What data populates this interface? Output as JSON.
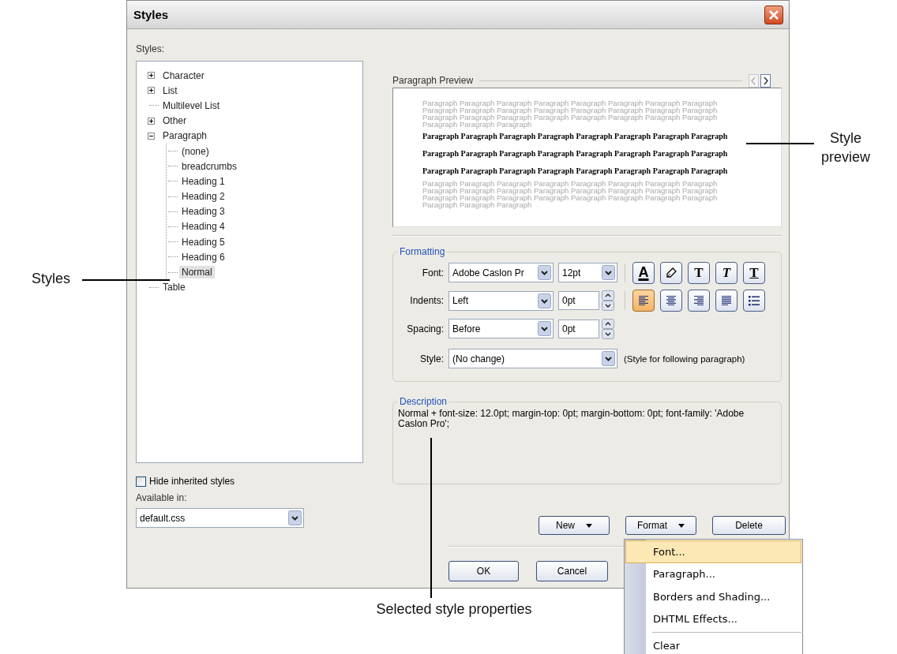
{
  "window": {
    "title": "Styles"
  },
  "styles_panel": {
    "label": "Styles:",
    "tree": [
      {
        "label": "Character",
        "selected": false,
        "expanded": false
      },
      {
        "label": "List",
        "selected": false,
        "expanded": false
      },
      {
        "label": "Multilevel List",
        "selected": false
      },
      {
        "label": "Other",
        "selected": false,
        "expanded": false
      },
      {
        "label": "Paragraph",
        "selected": false,
        "expanded": true,
        "children": [
          {
            "label": "(none)",
            "selected": false
          },
          {
            "label": "breadcrumbs",
            "selected": false
          },
          {
            "label": "Heading 1",
            "selected": false
          },
          {
            "label": "Heading 2",
            "selected": false
          },
          {
            "label": "Heading 3",
            "selected": false
          },
          {
            "label": "Heading 4",
            "selected": false
          },
          {
            "label": "Heading 5",
            "selected": false
          },
          {
            "label": "Heading 6",
            "selected": false
          },
          {
            "label": "Normal",
            "selected": true
          }
        ]
      },
      {
        "label": "Table",
        "selected": false
      }
    ],
    "hide_inherited": {
      "label": "Hide inherited styles",
      "checked": false
    },
    "available_in": {
      "label": "Available in:",
      "value": "default.css"
    }
  },
  "preview": {
    "label": "Paragraph Preview",
    "before": "Paragraph Paragraph Paragraph Paragraph Paragraph Paragraph Paragraph Paragraph Paragraph Paragraph Paragraph Paragraph Paragraph Paragraph Paragraph Paragraph Paragraph Paragraph Paragraph Paragraph Paragraph Paragraph Paragraph Paragraph Paragraph Paragraph Paragraph",
    "sample": "Paragraph Paragraph Paragraph Paragraph Paragraph Paragraph Paragraph Paragraph Paragraph Paragraph Paragraph Paragraph Paragraph Paragraph Paragraph Paragraph Paragraph Paragraph Paragraph Paragraph Paragraph Paragraph Paragraph Paragraph",
    "after": "Paragraph Paragraph Paragraph Paragraph Paragraph Paragraph Paragraph Paragraph Paragraph Paragraph Paragraph Paragraph Paragraph Paragraph Paragraph Paragraph Paragraph Paragraph Paragraph Paragraph Paragraph Paragraph Paragraph Paragraph Paragraph Paragraph Paragraph"
  },
  "formatting": {
    "label": "Formatting",
    "font": {
      "label": "Font:",
      "value": "Adobe Caslon Pr"
    },
    "size": {
      "value": "12pt"
    },
    "indents": {
      "label": "Indents:",
      "value": "Left",
      "amount": "0pt"
    },
    "spacing": {
      "label": "Spacing:",
      "value": "Before",
      "amount": "0pt"
    },
    "style": {
      "label": "Style:",
      "value": "(No change)",
      "hint": "(Style for following paragraph)"
    },
    "text_buttons": [
      {
        "kind": "font-color",
        "glyph": "A",
        "selected": false
      },
      {
        "kind": "highlight",
        "selected": false
      },
      {
        "kind": "bold",
        "glyph": "T",
        "selected": false
      },
      {
        "kind": "italic",
        "glyph": "T",
        "selected": false
      },
      {
        "kind": "underline",
        "glyph": "T",
        "selected": false
      }
    ],
    "paragraph_buttons": [
      {
        "kind": "align-left",
        "selected": true
      },
      {
        "kind": "align-center",
        "selected": false
      },
      {
        "kind": "align-right",
        "selected": false
      },
      {
        "kind": "justify",
        "selected": false
      },
      {
        "kind": "list",
        "selected": false
      }
    ]
  },
  "description": {
    "label": "Description",
    "text": "Normal +  font-size: 12.0pt;  margin-top: 0pt;  margin-bottom: 0pt;  font-family: 'Adobe Caslon Pro';"
  },
  "buttons": [
    {
      "label": "New",
      "kind": "dropdown"
    },
    {
      "label": "Format",
      "kind": "dropdown"
    },
    {
      "label": "Delete",
      "kind": "plain"
    }
  ],
  "footer_buttons": [
    {
      "label": "OK"
    },
    {
      "label": "Cancel"
    }
  ],
  "format_menu": {
    "groups": [
      [
        {
          "label": "Font...",
          "selected": true
        },
        {
          "label": "Paragraph...",
          "selected": false
        },
        {
          "label": "Borders and Shading...",
          "selected": false
        },
        {
          "label": "DHTML Effects...",
          "selected": false
        }
      ],
      [
        {
          "label": "Clear",
          "selected": false
        }
      ]
    ]
  },
  "annotations": [
    {
      "kind": "left",
      "text": "Styles"
    },
    {
      "kind": "right",
      "text": "Style preview"
    },
    {
      "kind": "bottom",
      "text": "Selected style properties"
    }
  ]
}
